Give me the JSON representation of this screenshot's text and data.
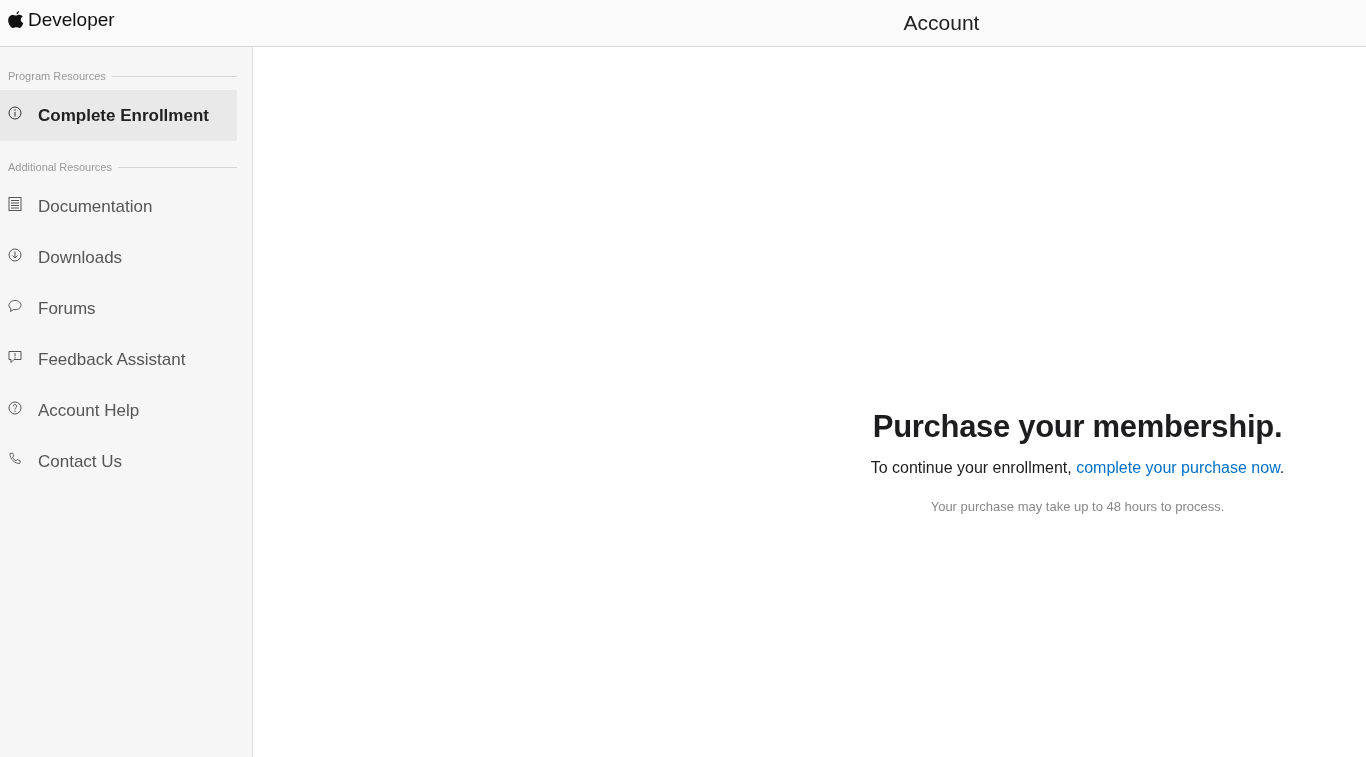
{
  "header": {
    "brand": "Developer",
    "title": "Account"
  },
  "sidebar": {
    "sections": [
      {
        "label": "Program Resources",
        "items": [
          {
            "label": "Complete Enrollment",
            "selected": true
          }
        ]
      },
      {
        "label": "Additional Resources",
        "items": [
          {
            "label": "Documentation",
            "selected": false
          },
          {
            "label": "Downloads",
            "selected": false
          },
          {
            "label": "Forums",
            "selected": false
          },
          {
            "label": "Feedback Assistant",
            "selected": false
          },
          {
            "label": "Account Help",
            "selected": false
          },
          {
            "label": "Contact Us",
            "selected": false
          }
        ]
      }
    ]
  },
  "content": {
    "heading": "Purchase your membership.",
    "text": "To continue your enrollment, ",
    "link": "complete your purchase now",
    "text_end": ".",
    "note": "Your purchase may take up to 48 hours to process."
  }
}
